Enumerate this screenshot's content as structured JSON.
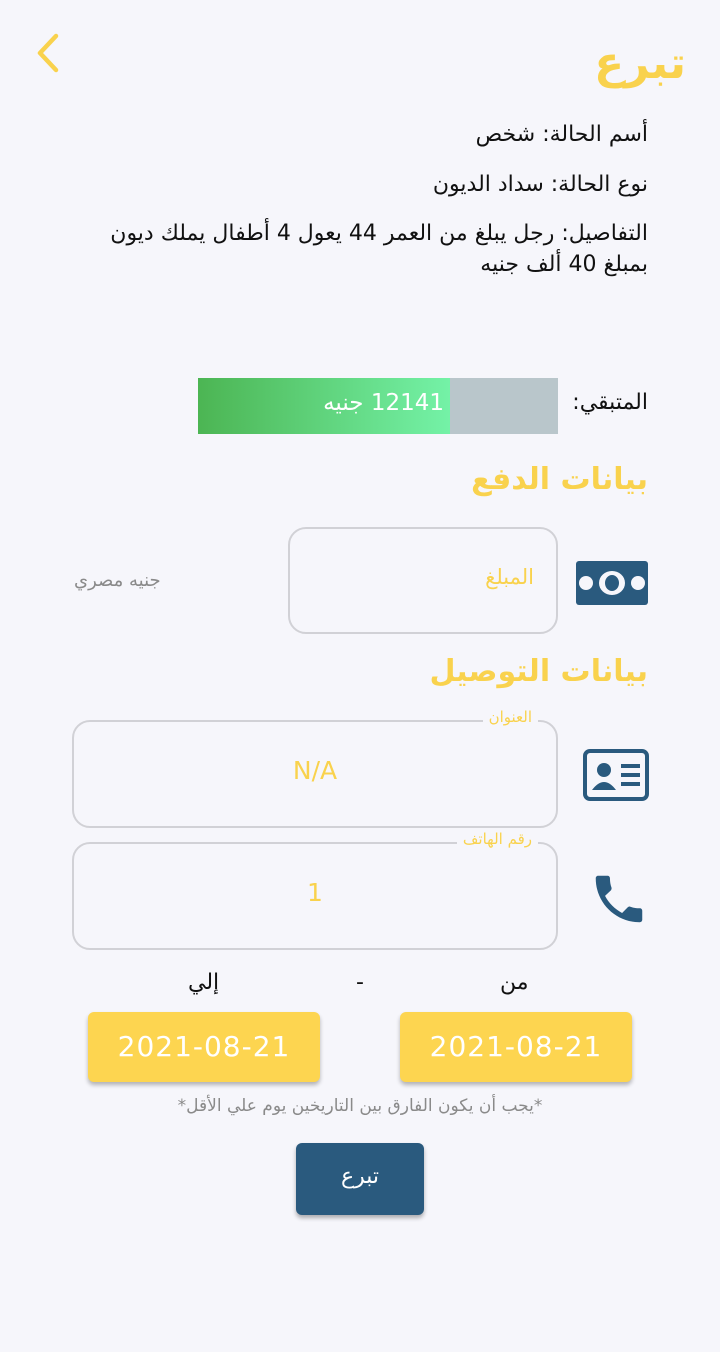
{
  "header": {
    "title": "تبرع",
    "back_icon": "chevron-left-icon"
  },
  "case": {
    "name": "أسم الحالة: شخص",
    "type": "نوع الحالة: سداد الديون",
    "details": "التفاصيل: رجل يبلغ من العمر 44 يعول 4 أطفال يملك ديون بمبلغ 40 ألف جنيه"
  },
  "remaining": {
    "label": "المتبقي:",
    "value_text": "12141 جنيه",
    "progress_fraction": 0.7
  },
  "payment": {
    "title": "بيانات الدفع",
    "amount_placeholder": "المبلغ",
    "currency": "جنيه مصري",
    "icon": "money-icon"
  },
  "delivery": {
    "title": "بيانات التوصيل",
    "address_label": "العنوان",
    "address_value": "N/A",
    "address_icon": "id-card-icon",
    "phone_label": "رقم الهاتف",
    "phone_value": "1",
    "phone_icon": "phone-icon"
  },
  "dates": {
    "from_label": "من",
    "separator": "-",
    "to_label": "إلي",
    "from_value": "2021-08-21",
    "to_value": "2021-08-21",
    "note": "*يجب أن يكون الفارق بين التاريخين يوم علي الأقل*"
  },
  "donate_button": "تبرع",
  "colors": {
    "accent": "#f9d24d",
    "primary": "#2a5a7e",
    "progress_start": "#4cb553",
    "progress_end": "#74f2a7"
  }
}
